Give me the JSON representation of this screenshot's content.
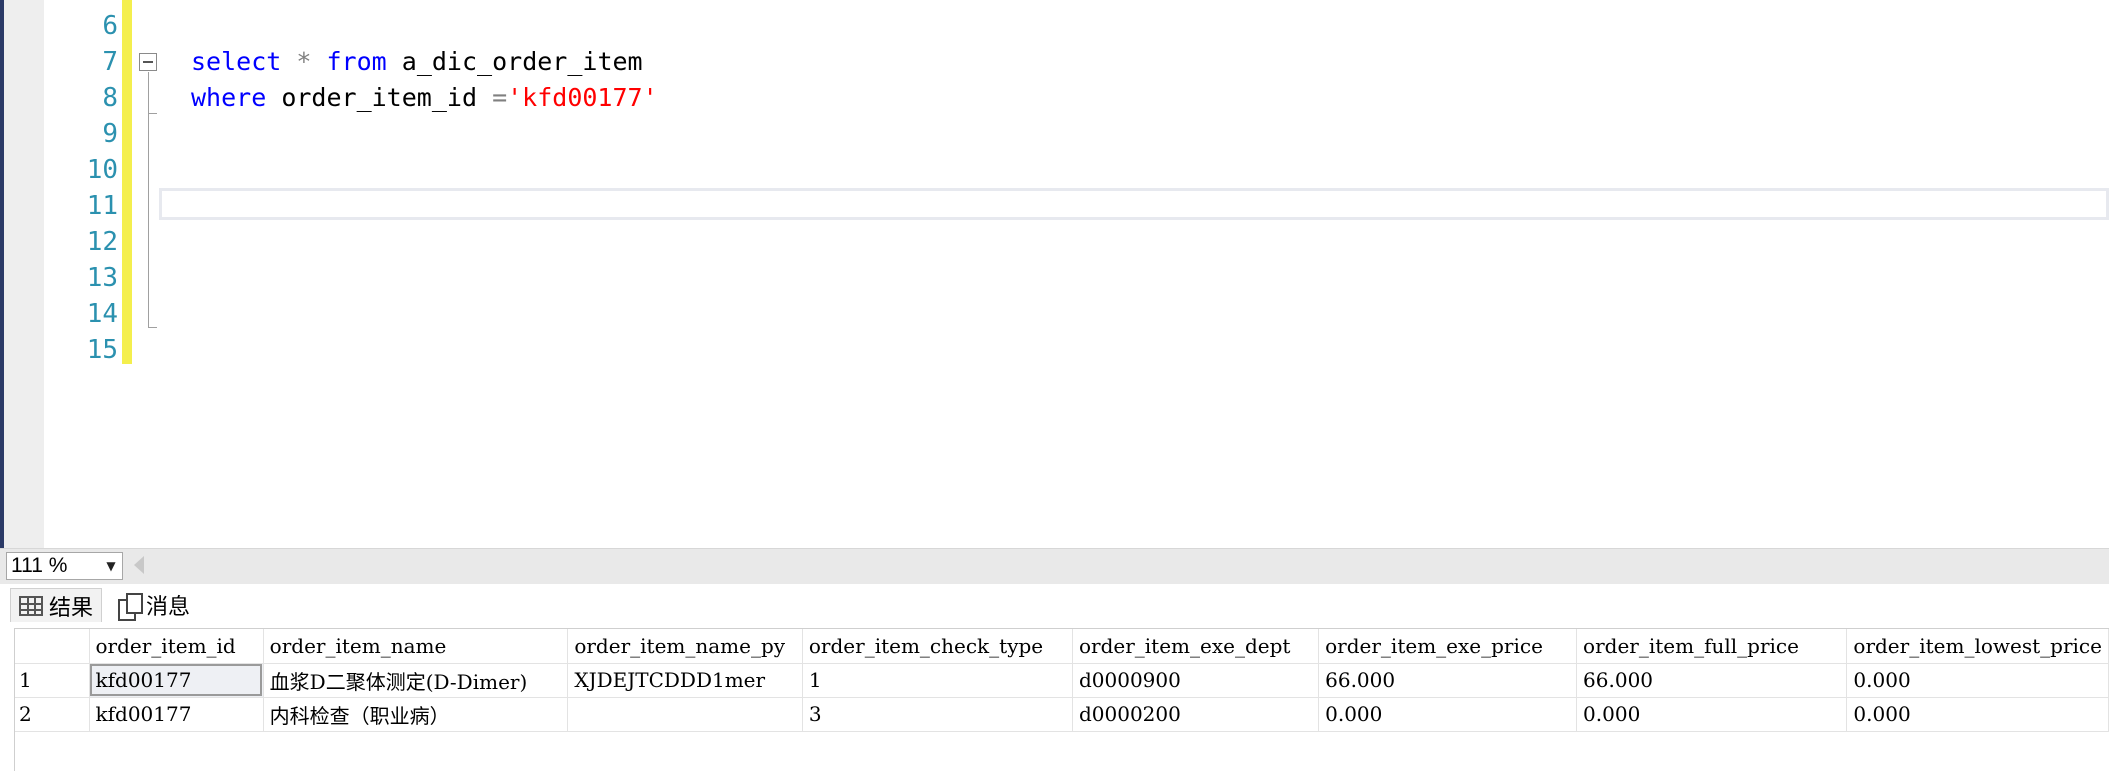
{
  "editor": {
    "line_numbers": [
      "6",
      "7",
      "8",
      "9",
      "10",
      "11",
      "12",
      "13",
      "14",
      "15"
    ],
    "code": {
      "line7": {
        "kw_select": "select",
        "star": "*",
        "kw_from": "from",
        "table": "a_dic_order_item"
      },
      "line8": {
        "kw_where": "where",
        "column": "order_item_id",
        "op": "=",
        "value": "'kfd00177'"
      }
    }
  },
  "status": {
    "zoom": "111 %"
  },
  "tabs": {
    "results": "结果",
    "messages": "消息"
  },
  "grid": {
    "columns": [
      "",
      "order_item_id",
      "order_item_name",
      "order_item_name_py",
      "order_item_check_type",
      "order_item_exe_dept",
      "order_item_exe_price",
      "order_item_full_price",
      "order_item_lowest_price"
    ],
    "rows": [
      [
        "1",
        "kfd00177",
        "血浆D二聚体测定(D-Dimer)",
        "XJDEJTCDDD1mer",
        "1",
        "d0000900",
        "66.000",
        "66.000",
        "0.000"
      ],
      [
        "2",
        "kfd00177",
        "内科检查（职业病）",
        "",
        "3",
        "d0000200",
        "0.000",
        "0.000",
        "0.000"
      ]
    ]
  },
  "colors": {
    "keyword": "#0000ff",
    "string": "#ff0000",
    "line_number": "#2b91af",
    "change_bar": "#f4ef4d"
  },
  "icons": {
    "results_tab": "grid-icon",
    "messages_tab": "messages-icon",
    "zoom_dropdown": "chevron-down-icon",
    "fold": "collapse-icon"
  }
}
